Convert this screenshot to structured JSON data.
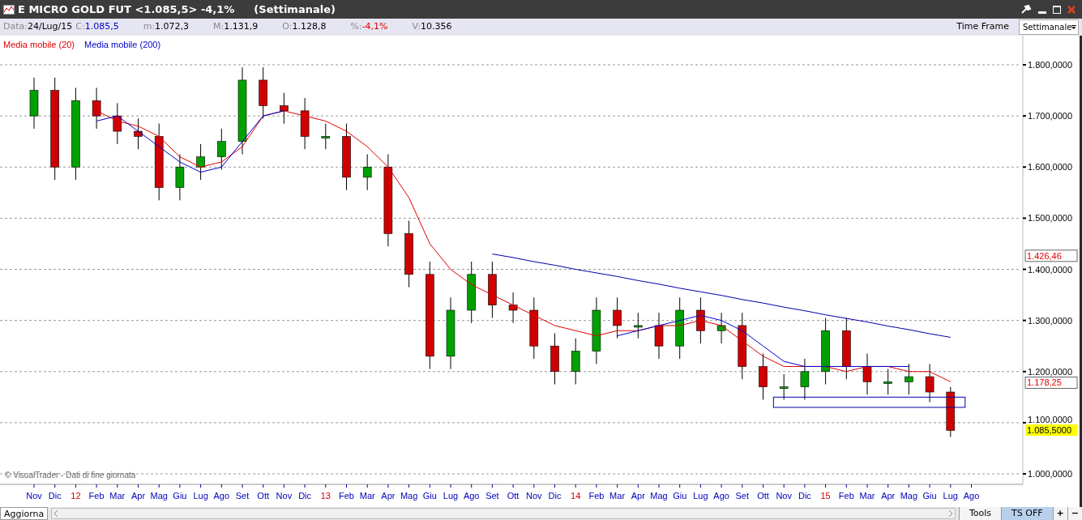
{
  "window": {
    "title": "E MICRO GOLD FUT <1.085,5> -4,1%",
    "subtitle": "(Settimanale)"
  },
  "info_bar": {
    "items": [
      {
        "label": "Data:",
        "value": "24/Lug/15",
        "color": "#000000"
      },
      {
        "label": "C:",
        "value": "1.085,5",
        "color": "#0000cc"
      },
      {
        "label": "m:",
        "value": "1.072,3",
        "color": "#000000"
      },
      {
        "label": "M:",
        "value": "1.131,9",
        "color": "#000000"
      },
      {
        "label": "O:",
        "value": "1.128,8",
        "color": "#000000"
      },
      {
        "label": "%:",
        "value": "-4,1%",
        "color": "#e00000"
      },
      {
        "label": "V:",
        "value": "10.356",
        "color": "#000000"
      }
    ],
    "time_frame_label": "Time Frame",
    "time_frame_value": "Settimanale"
  },
  "copyright": "© VisualTrader - Dati di fine giornata",
  "chart": {
    "chart_data": {
      "type": "candlestick",
      "grid": true,
      "categories": [
        "Nov",
        "Dic",
        "12",
        "Feb",
        "Mar",
        "Apr",
        "Mag",
        "Giu",
        "Lug",
        "Ago",
        "Set",
        "Ott",
        "Nov",
        "Dic",
        "13",
        "Feb",
        "Mar",
        "Apr",
        "Mag",
        "Giu",
        "Lug",
        "Ago",
        "Set",
        "Ott",
        "Nov",
        "Dic",
        "14",
        "Feb",
        "Mar",
        "Apr",
        "Mag",
        "Giu",
        "Lug",
        "Ago",
        "Set",
        "Ott",
        "Nov",
        "Dic",
        "15",
        "Feb",
        "Mar",
        "Apr",
        "Mag",
        "Giu",
        "Lug",
        "Ago"
      ],
      "ylim": [
        1000,
        1800
      ],
      "yticks": [
        {
          "value": 1000,
          "label": "1.000,0000"
        },
        {
          "value": 1100,
          "label": "1.100,0000"
        },
        {
          "value": 1200,
          "label": "1.200,0000"
        },
        {
          "value": 1300,
          "label": "1.300,0000"
        },
        {
          "value": 1400,
          "label": "1.400,0000"
        },
        {
          "value": 1500,
          "label": "1.500,0000"
        },
        {
          "value": 1600,
          "label": "1.600,0000"
        },
        {
          "value": 1700,
          "label": "1.700,0000"
        },
        {
          "value": 1800,
          "label": "1.800,0000"
        }
      ],
      "ohlc": [
        [
          1700,
          1775,
          1675,
          1750
        ],
        [
          1750,
          1775,
          1575,
          1600
        ],
        [
          1600,
          1755,
          1575,
          1730
        ],
        [
          1730,
          1755,
          1675,
          1700
        ],
        [
          1700,
          1725,
          1645,
          1670
        ],
        [
          1670,
          1695,
          1635,
          1660
        ],
        [
          1660,
          1685,
          1535,
          1560
        ],
        [
          1560,
          1625,
          1535,
          1600
        ],
        [
          1600,
          1645,
          1575,
          1620
        ],
        [
          1620,
          1675,
          1595,
          1650
        ],
        [
          1650,
          1795,
          1625,
          1770
        ],
        [
          1770,
          1795,
          1695,
          1720
        ],
        [
          1720,
          1745,
          1685,
          1710
        ],
        [
          1710,
          1735,
          1635,
          1660
        ],
        [
          1660,
          1685,
          1635,
          1660
        ],
        [
          1660,
          1685,
          1555,
          1580
        ],
        [
          1580,
          1625,
          1555,
          1600
        ],
        [
          1600,
          1625,
          1445,
          1470
        ],
        [
          1470,
          1495,
          1365,
          1390
        ],
        [
          1390,
          1415,
          1205,
          1230
        ],
        [
          1230,
          1345,
          1205,
          1320
        ],
        [
          1320,
          1415,
          1295,
          1390
        ],
        [
          1390,
          1415,
          1305,
          1330
        ],
        [
          1330,
          1355,
          1295,
          1320
        ],
        [
          1320,
          1345,
          1225,
          1250
        ],
        [
          1250,
          1275,
          1175,
          1200
        ],
        [
          1200,
          1265,
          1175,
          1240
        ],
        [
          1240,
          1345,
          1215,
          1320
        ],
        [
          1320,
          1345,
          1265,
          1290
        ],
        [
          1290,
          1315,
          1265,
          1290
        ],
        [
          1290,
          1315,
          1225,
          1250
        ],
        [
          1250,
          1345,
          1225,
          1320
        ],
        [
          1320,
          1345,
          1255,
          1280
        ],
        [
          1280,
          1315,
          1255,
          1290
        ],
        [
          1290,
          1315,
          1185,
          1210
        ],
        [
          1210,
          1235,
          1145,
          1170
        ],
        [
          1170,
          1195,
          1145,
          1170
        ],
        [
          1170,
          1225,
          1145,
          1200
        ],
        [
          1200,
          1305,
          1175,
          1280
        ],
        [
          1280,
          1305,
          1185,
          1210
        ],
        [
          1210,
          1235,
          1155,
          1180
        ],
        [
          1180,
          1205,
          1155,
          1180
        ],
        [
          1180,
          1215,
          1155,
          1190
        ],
        [
          1190,
          1215,
          1140,
          1160
        ],
        [
          1160,
          1170,
          1072,
          1085
        ],
        null
      ],
      "annotations": [
        "1.426,46",
        "1.178,25",
        "1.085,5000"
      ]
    },
    "overlay": {
      "chart_data": {
        "type": "line",
        "ylim": [
          1000,
          1800
        ],
        "series": [
          {
            "name": "Media mobile (20)",
            "color": "#e00000",
            "values": [
              null,
              null,
              null,
              1710,
              1690,
              1680,
              1660,
              1620,
              1600,
              1610,
              1640,
              1700,
              1710,
              1700,
              1690,
              1670,
              1640,
              1600,
              1540,
              1450,
              1400,
              1370,
              1350,
              1330,
              1310,
              1290,
              1280,
              1270,
              1280,
              1280,
              1290,
              1290,
              1300,
              1290,
              1260,
              1230,
              1210,
              1210,
              1210,
              1200,
              1210,
              1210,
              1200,
              1200,
              1180,
              null
            ]
          },
          {
            "name": "Media mobile (200)",
            "color": "#0000cc",
            "values": [
              null,
              null,
              null,
              1690,
              1700,
              1670,
              1640,
              1610,
              1590,
              1600,
              1650,
              1700,
              1710,
              null,
              null,
              null,
              null,
              null,
              null,
              null,
              null,
              null,
              null,
              null,
              null,
              null,
              null,
              null,
              1270,
              1280,
              1290,
              1300,
              1310,
              1300,
              1280,
              1250,
              1220,
              1210,
              1210,
              1210,
              1210,
              1210,
              1210,
              null,
              null,
              null
            ]
          },
          {
            "color": "#0000aa",
            "values": [
              null,
              null,
              null,
              null,
              null,
              null,
              null,
              null,
              null,
              null,
              null,
              null,
              null,
              null,
              null,
              null,
              null,
              null,
              null,
              null,
              null,
              null,
              1430,
              1423,
              1415,
              1408,
              1400,
              1393,
              1386,
              1378,
              1371,
              1363,
              1356,
              1349,
              1341,
              1334,
              1326,
              1319,
              1311,
              1304,
              1297,
              1289,
              1282,
              1274,
              1267,
              null
            ]
          }
        ]
      }
    }
  },
  "bottom_bar": {
    "update_button": "Aggiorna",
    "buttons": [
      {
        "label": "Tools",
        "selected": false
      },
      {
        "label": "TS OFF",
        "selected": true
      },
      {
        "label": "+",
        "selected": false
      },
      {
        "label": "−",
        "selected": false
      }
    ]
  }
}
